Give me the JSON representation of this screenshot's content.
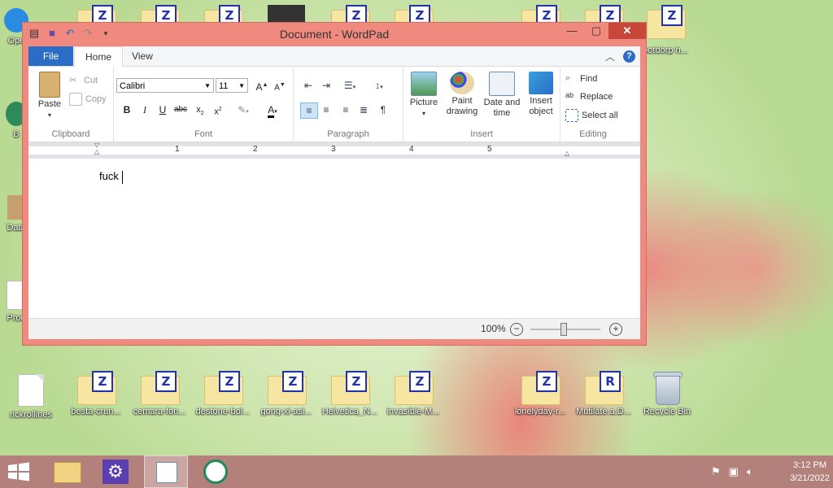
{
  "window": {
    "title": "Document - WordPad"
  },
  "tabs": {
    "file": "File",
    "home": "Home",
    "view": "View"
  },
  "clipboard": {
    "paste": "Paste",
    "cut": "Cut",
    "copy": "Copy",
    "group": "Clipboard"
  },
  "font": {
    "family": "Calibri",
    "size": "11",
    "group": "Font"
  },
  "paragraph": {
    "group": "Paragraph"
  },
  "insert": {
    "picture": "Picture",
    "paint_line1": "Paint",
    "paint_line2": "drawing",
    "date_line1": "Date and",
    "date_line2": "time",
    "object_line1": "Insert",
    "object_line2": "object",
    "group": "Insert"
  },
  "editing": {
    "find": "Find",
    "replace": "Replace",
    "select_all": "Select all",
    "group": "Editing"
  },
  "ruler": {
    "numbers": [
      "1",
      "2",
      "3",
      "4",
      "5"
    ]
  },
  "document": {
    "text": "fuck"
  },
  "status": {
    "zoom": "100%"
  },
  "desktop": {
    "top_row": [
      "Ope",
      "B",
      "Data",
      "Prod"
    ],
    "top_right_label": "ootdorp h...",
    "bottom_row": [
      "rickrollines",
      "besta-crun...",
      "cemara-fon...",
      "destone-bol...",
      "gong-xi-asi...",
      "Helvetica_N...",
      "invasible-M...",
      "lonelyday-r...",
      "Mutilate.a.D...",
      "Recycle Bin"
    ]
  },
  "clock": {
    "time": "3:12 PM",
    "date": "3/21/2022"
  },
  "colors": {
    "accent": "#2b6cc4",
    "frame": "#f08a7e",
    "taskbar": "#b3807b",
    "close": "#c7473b"
  }
}
